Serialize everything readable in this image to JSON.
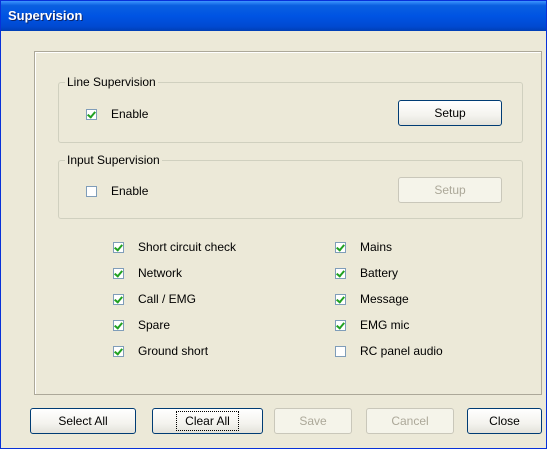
{
  "window": {
    "title": "Supervision"
  },
  "line_supervision": {
    "label": "Line Supervision",
    "enable_label": "Enable",
    "enable_checked": true,
    "setup_label": "Setup",
    "setup_enabled": true
  },
  "input_supervision": {
    "label": "Input Supervision",
    "enable_label": "Enable",
    "enable_checked": false,
    "setup_label": "Setup",
    "setup_enabled": false
  },
  "checks": {
    "left": [
      {
        "label": "Short circuit check",
        "checked": true
      },
      {
        "label": "Network",
        "checked": true
      },
      {
        "label": "Call / EMG",
        "checked": true
      },
      {
        "label": "Spare",
        "checked": true
      },
      {
        "label": "Ground short",
        "checked": true
      }
    ],
    "right": [
      {
        "label": "Mains",
        "checked": true
      },
      {
        "label": "Battery",
        "checked": true
      },
      {
        "label": "Message",
        "checked": true
      },
      {
        "label": "EMG mic",
        "checked": true
      },
      {
        "label": "RC panel audio",
        "checked": false
      }
    ]
  },
  "footer": {
    "select_all": "Select All",
    "clear_all": "Clear All",
    "save": "Save",
    "cancel": "Cancel",
    "close": "Close"
  }
}
